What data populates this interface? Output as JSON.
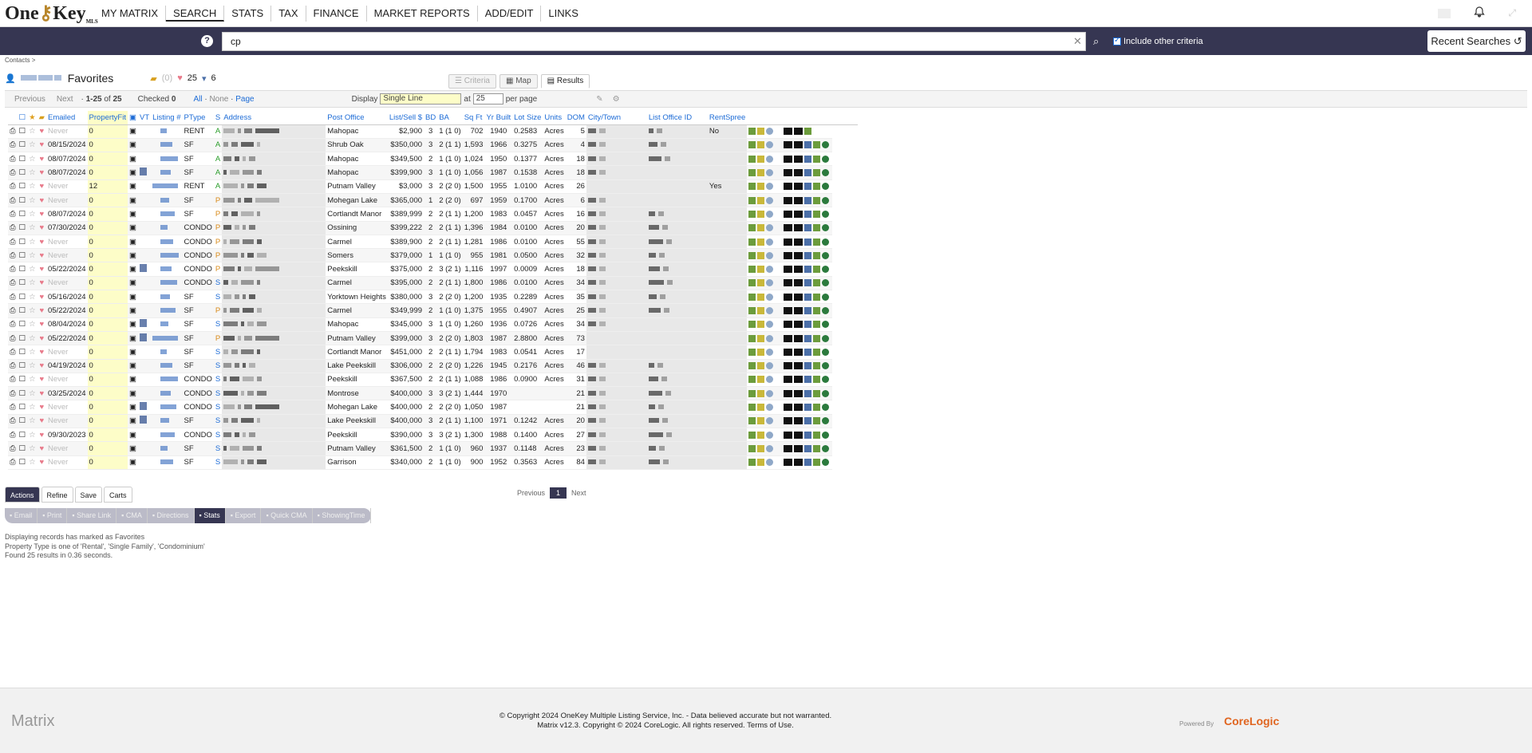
{
  "nav": {
    "items": [
      "MY MATRIX",
      "SEARCH",
      "STATS",
      "TAX",
      "FINANCE",
      "MARKET REPORTS",
      "ADD/EDIT",
      "LINKS"
    ]
  },
  "search": {
    "value": "cp",
    "include_label": "Include other criteria",
    "recent": "Recent Searches"
  },
  "crumb": "Contacts >",
  "fav": {
    "title": "Favorites",
    "c1": "(0)",
    "c2": "25",
    "c3": "6"
  },
  "tabs": {
    "criteria": "Criteria",
    "map": "Map",
    "results": "Results"
  },
  "toolbar": {
    "prev": "Previous",
    "next": "Next",
    "range": "1-25",
    "of": "of",
    "total": "25",
    "checked": "Checked",
    "checked_n": "0",
    "all": "All",
    "none": "None",
    "page": "Page",
    "display": "Display",
    "display_val": "Single Line",
    "at": "at",
    "per": "25",
    "perpage": "per page"
  },
  "headers": [
    "Emailed",
    "PropertyFit",
    "VT",
    "Listing #",
    "PType",
    "S",
    "Address",
    "Post Office",
    "List/Sell $",
    "BD",
    "BA",
    "Sq Ft",
    "Yr Built",
    "Lot Size",
    "Units",
    "DOM",
    "City/Town",
    "List Office ID",
    "RentSpree"
  ],
  "rows": [
    [
      "Never",
      "0",
      "RENT",
      "A",
      "Mahopac",
      "$2,900",
      "3",
      "1 (1 0)",
      "702",
      "1940",
      "0.2583",
      "Acres",
      "5",
      "No"
    ],
    [
      "08/15/2024",
      "0",
      "SF",
      "A",
      "Shrub Oak",
      "$350,000",
      "3",
      "2 (1 1)",
      "1,593",
      "1966",
      "0.3275",
      "Acres",
      "4",
      ""
    ],
    [
      "08/07/2024",
      "0",
      "SF",
      "A",
      "Mahopac",
      "$349,500",
      "2",
      "1 (1 0)",
      "1,024",
      "1950",
      "0.1377",
      "Acres",
      "18",
      ""
    ],
    [
      "08/07/2024",
      "0",
      "SF",
      "A",
      "Mahopac",
      "$399,900",
      "3",
      "1 (1 0)",
      "1,056",
      "1987",
      "0.1538",
      "Acres",
      "18",
      ""
    ],
    [
      "Never",
      "12",
      "RENT",
      "A",
      "Putnam Valley",
      "$3,000",
      "3",
      "2 (2 0)",
      "1,500",
      "1955",
      "1.0100",
      "Acres",
      "26",
      "Yes"
    ],
    [
      "Never",
      "0",
      "SF",
      "P",
      "Mohegan Lake",
      "$365,000",
      "1",
      "2 (2 0)",
      "697",
      "1959",
      "0.1700",
      "Acres",
      "6",
      ""
    ],
    [
      "08/07/2024",
      "0",
      "SF",
      "P",
      "Cortlandt Manor",
      "$389,999",
      "2",
      "2 (1 1)",
      "1,200",
      "1983",
      "0.0457",
      "Acres",
      "16",
      ""
    ],
    [
      "07/30/2024",
      "0",
      "CONDO",
      "P",
      "Ossining",
      "$399,222",
      "2",
      "2 (1 1)",
      "1,396",
      "1984",
      "0.0100",
      "Acres",
      "20",
      ""
    ],
    [
      "Never",
      "0",
      "CONDO",
      "P",
      "Carmel",
      "$389,900",
      "2",
      "2 (1 1)",
      "1,281",
      "1986",
      "0.0100",
      "Acres",
      "55",
      ""
    ],
    [
      "Never",
      "0",
      "CONDO",
      "P",
      "Somers",
      "$379,000",
      "1",
      "1 (1 0)",
      "955",
      "1981",
      "0.0500",
      "Acres",
      "32",
      ""
    ],
    [
      "05/22/2024",
      "0",
      "CONDO",
      "P",
      "Peekskill",
      "$375,000",
      "2",
      "3 (2 1)",
      "1,116",
      "1997",
      "0.0009",
      "Acres",
      "18",
      ""
    ],
    [
      "Never",
      "0",
      "CONDO",
      "S",
      "Carmel",
      "$395,000",
      "2",
      "2 (1 1)",
      "1,800",
      "1986",
      "0.0100",
      "Acres",
      "34",
      ""
    ],
    [
      "05/16/2024",
      "0",
      "SF",
      "S",
      "Yorktown Heights",
      "$380,000",
      "3",
      "2 (2 0)",
      "1,200",
      "1935",
      "0.2289",
      "Acres",
      "35",
      ""
    ],
    [
      "05/22/2024",
      "0",
      "SF",
      "P",
      "Carmel",
      "$349,999",
      "2",
      "1 (1 0)",
      "1,375",
      "1955",
      "0.4907",
      "Acres",
      "25",
      ""
    ],
    [
      "08/04/2024",
      "0",
      "SF",
      "S",
      "Mahopac",
      "$345,000",
      "3",
      "1 (1 0)",
      "1,260",
      "1936",
      "0.0726",
      "Acres",
      "34",
      ""
    ],
    [
      "05/22/2024",
      "0",
      "SF",
      "P",
      "Putnam Valley",
      "$399,000",
      "3",
      "2 (2 0)",
      "1,803",
      "1987",
      "2.8800",
      "Acres",
      "73",
      ""
    ],
    [
      "Never",
      "0",
      "SF",
      "S",
      "Cortlandt Manor",
      "$451,000",
      "2",
      "2 (1 1)",
      "1,794",
      "1983",
      "0.0541",
      "Acres",
      "17",
      ""
    ],
    [
      "04/19/2024",
      "0",
      "SF",
      "S",
      "Lake Peekskill",
      "$306,000",
      "2",
      "2 (2 0)",
      "1,226",
      "1945",
      "0.2176",
      "Acres",
      "46",
      ""
    ],
    [
      "Never",
      "0",
      "CONDO",
      "S",
      "Peekskill",
      "$367,500",
      "2",
      "2 (1 1)",
      "1,088",
      "1986",
      "0.0900",
      "Acres",
      "31",
      ""
    ],
    [
      "03/25/2024",
      "0",
      "CONDO",
      "S",
      "Montrose",
      "$400,000",
      "3",
      "3 (2 1)",
      "1,444",
      "1970",
      "",
      "",
      "21",
      ""
    ],
    [
      "Never",
      "0",
      "CONDO",
      "S",
      "Mohegan Lake",
      "$400,000",
      "2",
      "2 (2 0)",
      "1,050",
      "1987",
      "",
      "",
      "21",
      ""
    ],
    [
      "Never",
      "0",
      "SF",
      "S",
      "Lake Peekskill",
      "$400,000",
      "3",
      "2 (1 1)",
      "1,100",
      "1971",
      "0.1242",
      "Acres",
      "20",
      ""
    ],
    [
      "09/30/2023",
      "0",
      "CONDO",
      "S",
      "Peekskill",
      "$390,000",
      "3",
      "3 (2 1)",
      "1,300",
      "1988",
      "0.1400",
      "Acres",
      "27",
      ""
    ],
    [
      "Never",
      "0",
      "SF",
      "S",
      "Putnam Valley",
      "$361,500",
      "2",
      "1 (1 0)",
      "960",
      "1937",
      "0.1148",
      "Acres",
      "23",
      ""
    ],
    [
      "Never",
      "0",
      "SF",
      "S",
      "Garrison",
      "$340,000",
      "2",
      "1 (1 0)",
      "900",
      "1952",
      "0.3563",
      "Acres",
      "84",
      ""
    ]
  ],
  "actions": {
    "tabs": [
      "Actions",
      "Refine",
      "Save",
      "Carts"
    ],
    "bar": [
      "Email",
      "Print",
      "Share Link",
      "CMA",
      "Directions",
      "Stats",
      "Export",
      "Quick CMA",
      "ShowingTime"
    ]
  },
  "pager": {
    "prev": "Previous",
    "page": "1",
    "next": "Next"
  },
  "notes": [
    "Displaying records has marked as Favorites",
    "Property Type is one of 'Rental', 'Single Family', 'Condominium'",
    "Found 25 results in 0.36 seconds."
  ],
  "footer": {
    "matrix": "Matrix",
    "l1": "© Copyright 2024 OneKey Multiple Listing Service, Inc. - Data believed accurate but not warranted.",
    "l2": "Matrix v12.3. Copyright © 2024 CoreLogic. All rights reserved. Terms of Use.",
    "powered": "Powered By",
    "cl": "CoreLogic"
  }
}
